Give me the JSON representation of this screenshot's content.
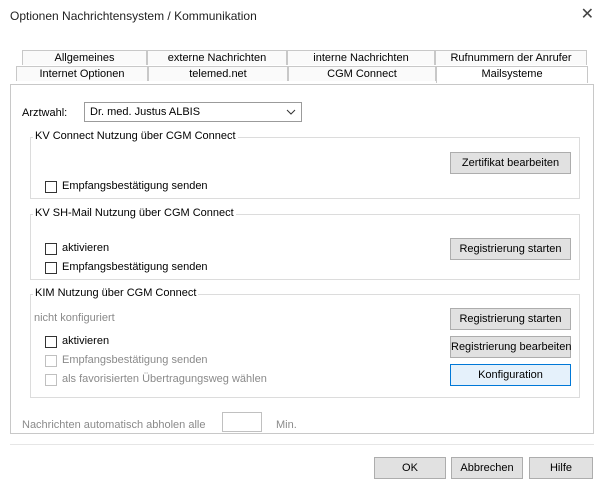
{
  "window": {
    "title": "Optionen Nachrichtensystem / Kommunikation",
    "close_glyph": "✕"
  },
  "tabs_row1": [
    "Allgemeines",
    "externe Nachrichten",
    "interne Nachrichten",
    "Rufnummern der Anrufer"
  ],
  "tabs_row2": [
    "Internet Optionen",
    "telemed.net",
    "CGM Connect",
    "Mailsysteme"
  ],
  "arztwahl": {
    "label": "Arztwahl:",
    "value": "Dr. med. Justus  ALBIS"
  },
  "kv_connect": {
    "title": "KV Connect Nutzung über CGM Connect",
    "cert_button": "Zertifikat bearbeiten",
    "empfang": "Empfangsbestätigung senden"
  },
  "kv_sh": {
    "title": "KV SH-Mail Nutzung über CGM Connect",
    "aktivieren": "aktivieren",
    "empfang": "Empfangsbestätigung senden",
    "register_button": "Registrierung starten"
  },
  "kim": {
    "title": "KIM Nutzung über CGM Connect",
    "status": "nicht konfiguriert",
    "aktivieren": "aktivieren",
    "empfang": "Empfangsbestätigung senden",
    "favorit": "als favorisierten Übertragungsweg wählen",
    "register_button": "Registrierung starten",
    "edit_button": "Registrierung bearbeiten",
    "config_button": "Konfiguration"
  },
  "auto_fetch": {
    "label": "Nachrichten automatisch abholen alle",
    "value": "",
    "unit": "Min."
  },
  "footer": {
    "ok": "OK",
    "cancel": "Abbrechen",
    "help": "Hilfe"
  },
  "colors": {
    "arrow": "#e00000",
    "focus_border": "#0078d7"
  }
}
